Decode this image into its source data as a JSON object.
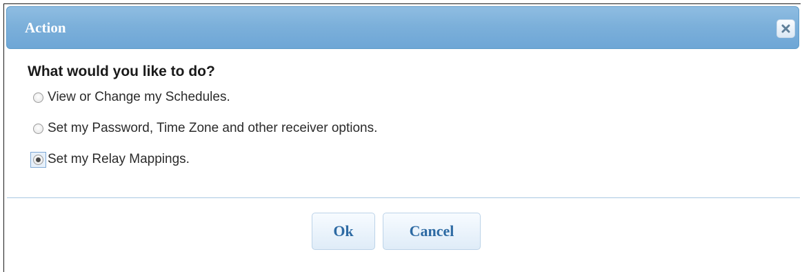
{
  "dialog": {
    "title": "Action",
    "close_icon": "close-icon",
    "question": "What would you like to do?",
    "options": [
      {
        "label": "View or Change my Schedules.",
        "checked": false
      },
      {
        "label": "Set my Password, Time Zone and other receiver options.",
        "checked": false
      },
      {
        "label": "Set my Relay Mappings.",
        "checked": true
      }
    ],
    "buttons": {
      "ok_label": "Ok",
      "cancel_label": "Cancel"
    }
  },
  "colors": {
    "titlebar": "#7cb0da",
    "button_text": "#2d6aa3",
    "divider": "#a9c8e2"
  }
}
